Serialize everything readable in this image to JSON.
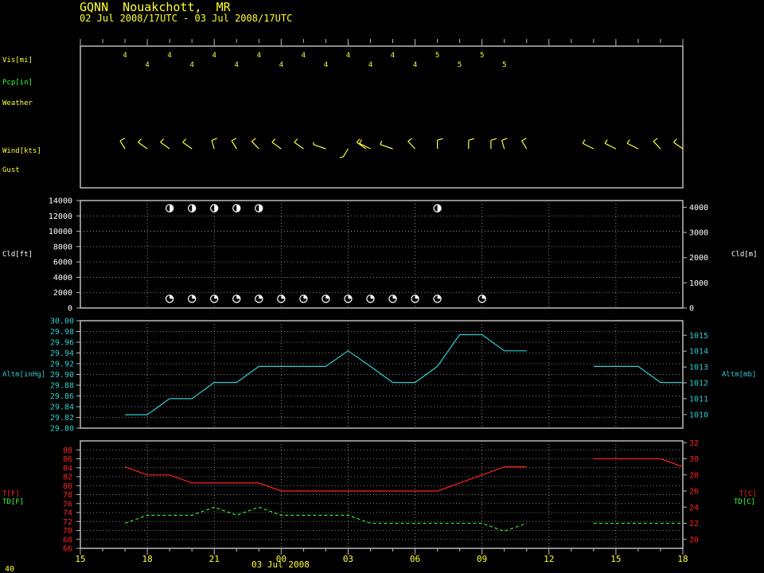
{
  "header": {
    "station": "GQNN  Nouakchott,  MR",
    "period": "02 Jul 2008/17UTC - 03 Jul 2008/17UTC"
  },
  "colors": {
    "yellow": "#ffff33",
    "green": "#33ff33",
    "white": "#ffffff",
    "cyan": "#33cccc",
    "red": "#ff2222",
    "frame": "#bbbbbb",
    "grid": "#aaaaaa"
  },
  "labels": {
    "vis": "Vis[mi]",
    "pcp": "Pcp[in]",
    "weather": "Weather",
    "wind": "Wind[kts]",
    "gust": "Gust",
    "cld_left": "Cld[ft]",
    "cld_right": "Cld[m]",
    "altm_left": "Altm[inHg]",
    "altm_right": "Altm[mb]",
    "temp_f": "T[F]",
    "dew_f": "TD[F]",
    "temp_c": "T[C]",
    "dew_c": "TD[C]"
  },
  "footer": {
    "date": "03 Jul 2008",
    "corner": "40"
  },
  "chart_data": {
    "type": "line",
    "x_axis": {
      "range_hours": [
        15,
        42
      ],
      "tick_labels": [
        "15",
        "18",
        "21",
        "00",
        "03",
        "06",
        "09",
        "12",
        "15",
        "18"
      ],
      "tick_hours": [
        15,
        18,
        21,
        24,
        27,
        30,
        33,
        36,
        39,
        42
      ]
    },
    "visibility": {
      "hours": [
        17,
        18,
        19,
        20,
        21,
        22,
        23,
        24,
        25,
        26,
        27,
        28,
        29,
        30,
        31,
        32,
        33,
        34
      ],
      "values": [
        "4",
        "4",
        "4",
        "4",
        "4",
        "4",
        "4",
        "4",
        "4",
        "4",
        "4",
        "4",
        "4",
        "4",
        "5",
        "5",
        "5",
        "5"
      ]
    },
    "wind": {
      "hours": [
        17,
        18,
        19,
        20,
        21,
        22,
        23,
        24,
        25,
        26,
        27,
        27.8,
        28,
        29,
        30,
        31,
        32.4,
        33.4,
        34,
        35,
        38,
        39,
        40,
        41,
        42
      ],
      "direction_deg": [
        340,
        320,
        320,
        320,
        350,
        340,
        330,
        320,
        320,
        300,
        200,
        320,
        310,
        300,
        330,
        360,
        360,
        360,
        350,
        340,
        310,
        310,
        310,
        330,
        320
      ],
      "speed_kts": [
        10,
        10,
        10,
        10,
        10,
        10,
        10,
        10,
        10,
        5,
        5,
        10,
        10,
        10,
        10,
        10,
        10,
        10,
        10,
        10,
        10,
        10,
        10,
        10,
        10
      ]
    },
    "clouds": {
      "y_label_left": "Cld[ft]",
      "y_label_right": "Cld[m]",
      "ylim_ft": [
        0,
        14000
      ],
      "yticks_ft": [
        0,
        2000,
        4000,
        6000,
        8000,
        10000,
        12000,
        14000
      ],
      "yticks_m": [
        0,
        1000,
        2000,
        3000,
        4000
      ],
      "high_layer": {
        "hours": [
          19,
          20,
          21,
          22,
          23,
          31
        ],
        "height_ft": 13000,
        "cover": "half"
      },
      "low_layer": {
        "hours": [
          19,
          20,
          21,
          22,
          23,
          24,
          25,
          26,
          27,
          28,
          29,
          30,
          31,
          33
        ],
        "height_ft": 1200,
        "cover": "few-scattered"
      }
    },
    "altimeter": {
      "y_label_left": "Altm[inHg]",
      "y_label_right": "Altm[mb]",
      "ylim": [
        29.8,
        30.0
      ],
      "yticks_inhg": [
        "29.80",
        "29.82",
        "29.84",
        "29.86",
        "29.88",
        "29.90",
        "29.92",
        "29.94",
        "29.96",
        "29.98",
        "30.00"
      ],
      "yticks_mb": [
        "1010",
        "1011",
        "1012",
        "1013",
        "1014",
        "1015"
      ],
      "segments": [
        {
          "hours": [
            17,
            18,
            19,
            20,
            21,
            22,
            23,
            24,
            25,
            26,
            27,
            28,
            29,
            30,
            31,
            32,
            33,
            34,
            35
          ],
          "values": [
            29.825,
            29.825,
            29.855,
            29.855,
            29.885,
            29.885,
            29.915,
            29.915,
            29.915,
            29.915,
            29.944,
            29.915,
            29.885,
            29.885,
            29.915,
            29.974,
            29.974,
            29.944,
            29.944
          ]
        },
        {
          "hours": [
            38,
            39,
            40,
            41,
            42
          ],
          "values": [
            29.915,
            29.915,
            29.915,
            29.885,
            29.885
          ]
        }
      ]
    },
    "temperature": {
      "y_label_left": "T[F]",
      "y_label_right": "T[C]",
      "ylim_f": [
        66,
        90
      ],
      "yticks_f": [
        "66",
        "68",
        "70",
        "72",
        "74",
        "76",
        "78",
        "80",
        "82",
        "84",
        "86",
        "88"
      ],
      "yticks_c": [
        "20",
        "22",
        "24",
        "26",
        "28",
        "30",
        "32"
      ],
      "temp_segments": [
        {
          "hours": [
            17,
            18,
            19,
            20,
            21,
            22,
            23,
            24,
            25,
            26,
            27,
            28,
            29,
            30,
            31,
            32,
            33,
            34,
            35
          ],
          "values": [
            84.2,
            82.4,
            82.4,
            80.6,
            80.6,
            80.6,
            80.6,
            78.8,
            78.8,
            78.8,
            78.8,
            78.8,
            78.8,
            78.8,
            78.8,
            80.6,
            82.4,
            84.2,
            84.2
          ]
        },
        {
          "hours": [
            38,
            39,
            40,
            41,
            42
          ],
          "values": [
            86.0,
            86.0,
            86.0,
            86.0,
            84.2
          ]
        }
      ],
      "dew_segments": [
        {
          "hours": [
            17,
            18,
            19,
            20,
            21,
            22,
            23,
            24,
            25,
            26,
            27,
            28,
            29,
            30,
            31,
            32,
            33,
            34,
            35
          ],
          "values": [
            71.6,
            73.4,
            73.4,
            73.4,
            75.2,
            73.4,
            75.2,
            73.4,
            73.4,
            73.4,
            73.4,
            71.6,
            71.6,
            71.6,
            71.6,
            71.6,
            71.6,
            69.8,
            71.6
          ]
        },
        {
          "hours": [
            38,
            39,
            40,
            41,
            42
          ],
          "values": [
            71.6,
            71.6,
            71.6,
            71.6,
            71.6
          ]
        }
      ]
    }
  }
}
